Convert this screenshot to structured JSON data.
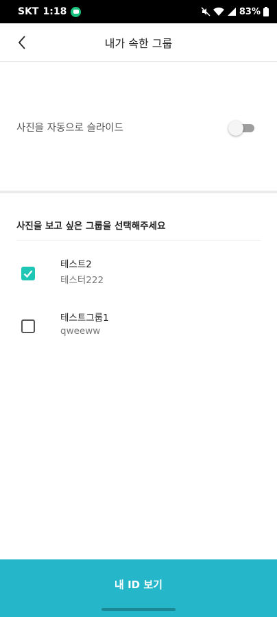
{
  "status_bar": {
    "carrier": "SKT",
    "time": "1:18",
    "battery": "83%"
  },
  "header": {
    "title": "내가 속한 그룹",
    "back_icon": "chevron-left-icon"
  },
  "auto_slide": {
    "label": "사진을 자동으로 슬라이드",
    "enabled": false
  },
  "group_selection": {
    "title": "사진을 보고 싶은 그룹을 선택해주세요",
    "groups": [
      {
        "name": "테스트2",
        "description": "테스터222",
        "checked": true
      },
      {
        "name": "테스트그룹1",
        "description": "qweeww",
        "checked": false
      }
    ]
  },
  "bottom_button": {
    "label": "내 ID 보기"
  },
  "colors": {
    "accent_teal": "#1ec6b6",
    "button_blue": "#26b6c9"
  }
}
